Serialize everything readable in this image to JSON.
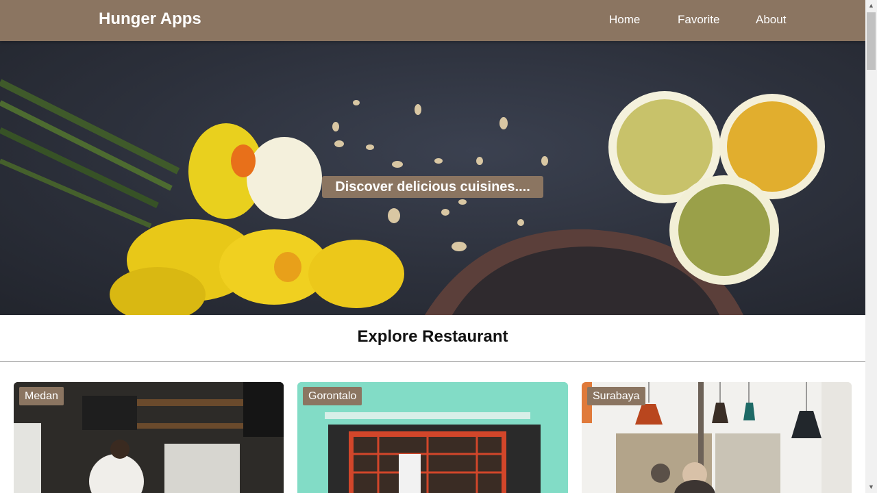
{
  "header": {
    "brand": "Hunger Apps",
    "nav": [
      "Home",
      "Favorite",
      "About"
    ]
  },
  "hero": {
    "title": "Discover delicious cuisines...."
  },
  "section": {
    "title": "Explore Restaurant"
  },
  "restaurants": [
    {
      "city": "Medan"
    },
    {
      "city": "Gorontalo"
    },
    {
      "city": "Surabaya"
    }
  ],
  "colors": {
    "brand": "#8b7561",
    "hero_bg": "#2c303b"
  }
}
